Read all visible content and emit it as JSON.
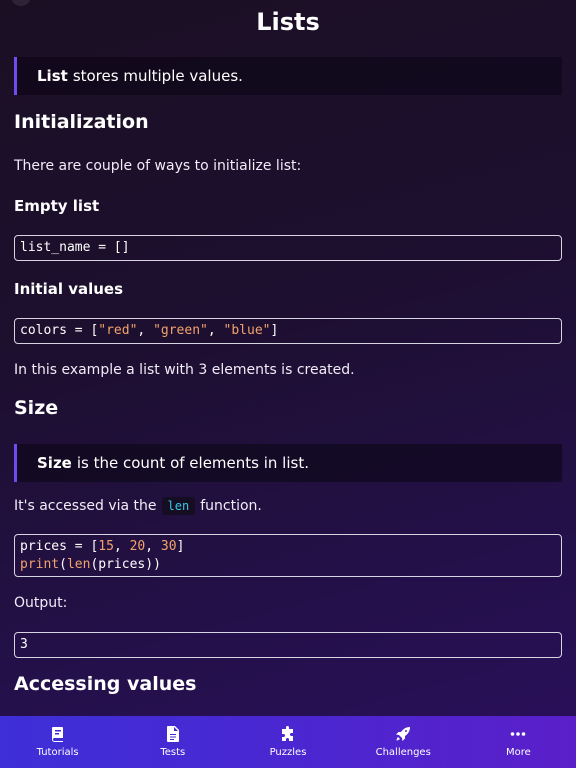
{
  "page": {
    "title": "Lists"
  },
  "intro_note": {
    "bold": "List",
    "text": "stores multiple values."
  },
  "init": {
    "heading": "Initialization",
    "text": "There are couple of ways to initialize list:",
    "empty_heading": "Empty list",
    "empty_code": "list_name = []",
    "initial_heading": "Initial values",
    "initial_code": {
      "prefix": "colors = [",
      "items": [
        "\"red\"",
        "\"green\"",
        "\"blue\""
      ],
      "sep": ", ",
      "suffix": "]"
    },
    "example_text": "In this example a list with 3 elements is created."
  },
  "size": {
    "heading": "Size",
    "note_bold": "Size",
    "note_text": "is the count of elements in list.",
    "access_before": "It's accessed via the",
    "access_code": "len",
    "access_after": "function.",
    "code_line1": {
      "prefix": "prices = [",
      "n1": "15",
      "n2": "20",
      "n3": "30",
      "sep": ", ",
      "suffix": "]"
    },
    "code_line2": {
      "fn_print": "print",
      "open": "(",
      "fn_len": "len",
      "arg": "(prices))"
    },
    "output_label": "Output:",
    "output_value": "3"
  },
  "accessing": {
    "heading": "Accessing values"
  },
  "tabbar": {
    "tabs": [
      {
        "label": "Tutorials",
        "icon": "book-icon"
      },
      {
        "label": "Tests",
        "icon": "document-icon"
      },
      {
        "label": "Puzzles",
        "icon": "puzzle-icon"
      },
      {
        "label": "Challenges",
        "icon": "rocket-icon"
      },
      {
        "label": "More",
        "icon": "more-icon"
      }
    ]
  }
}
